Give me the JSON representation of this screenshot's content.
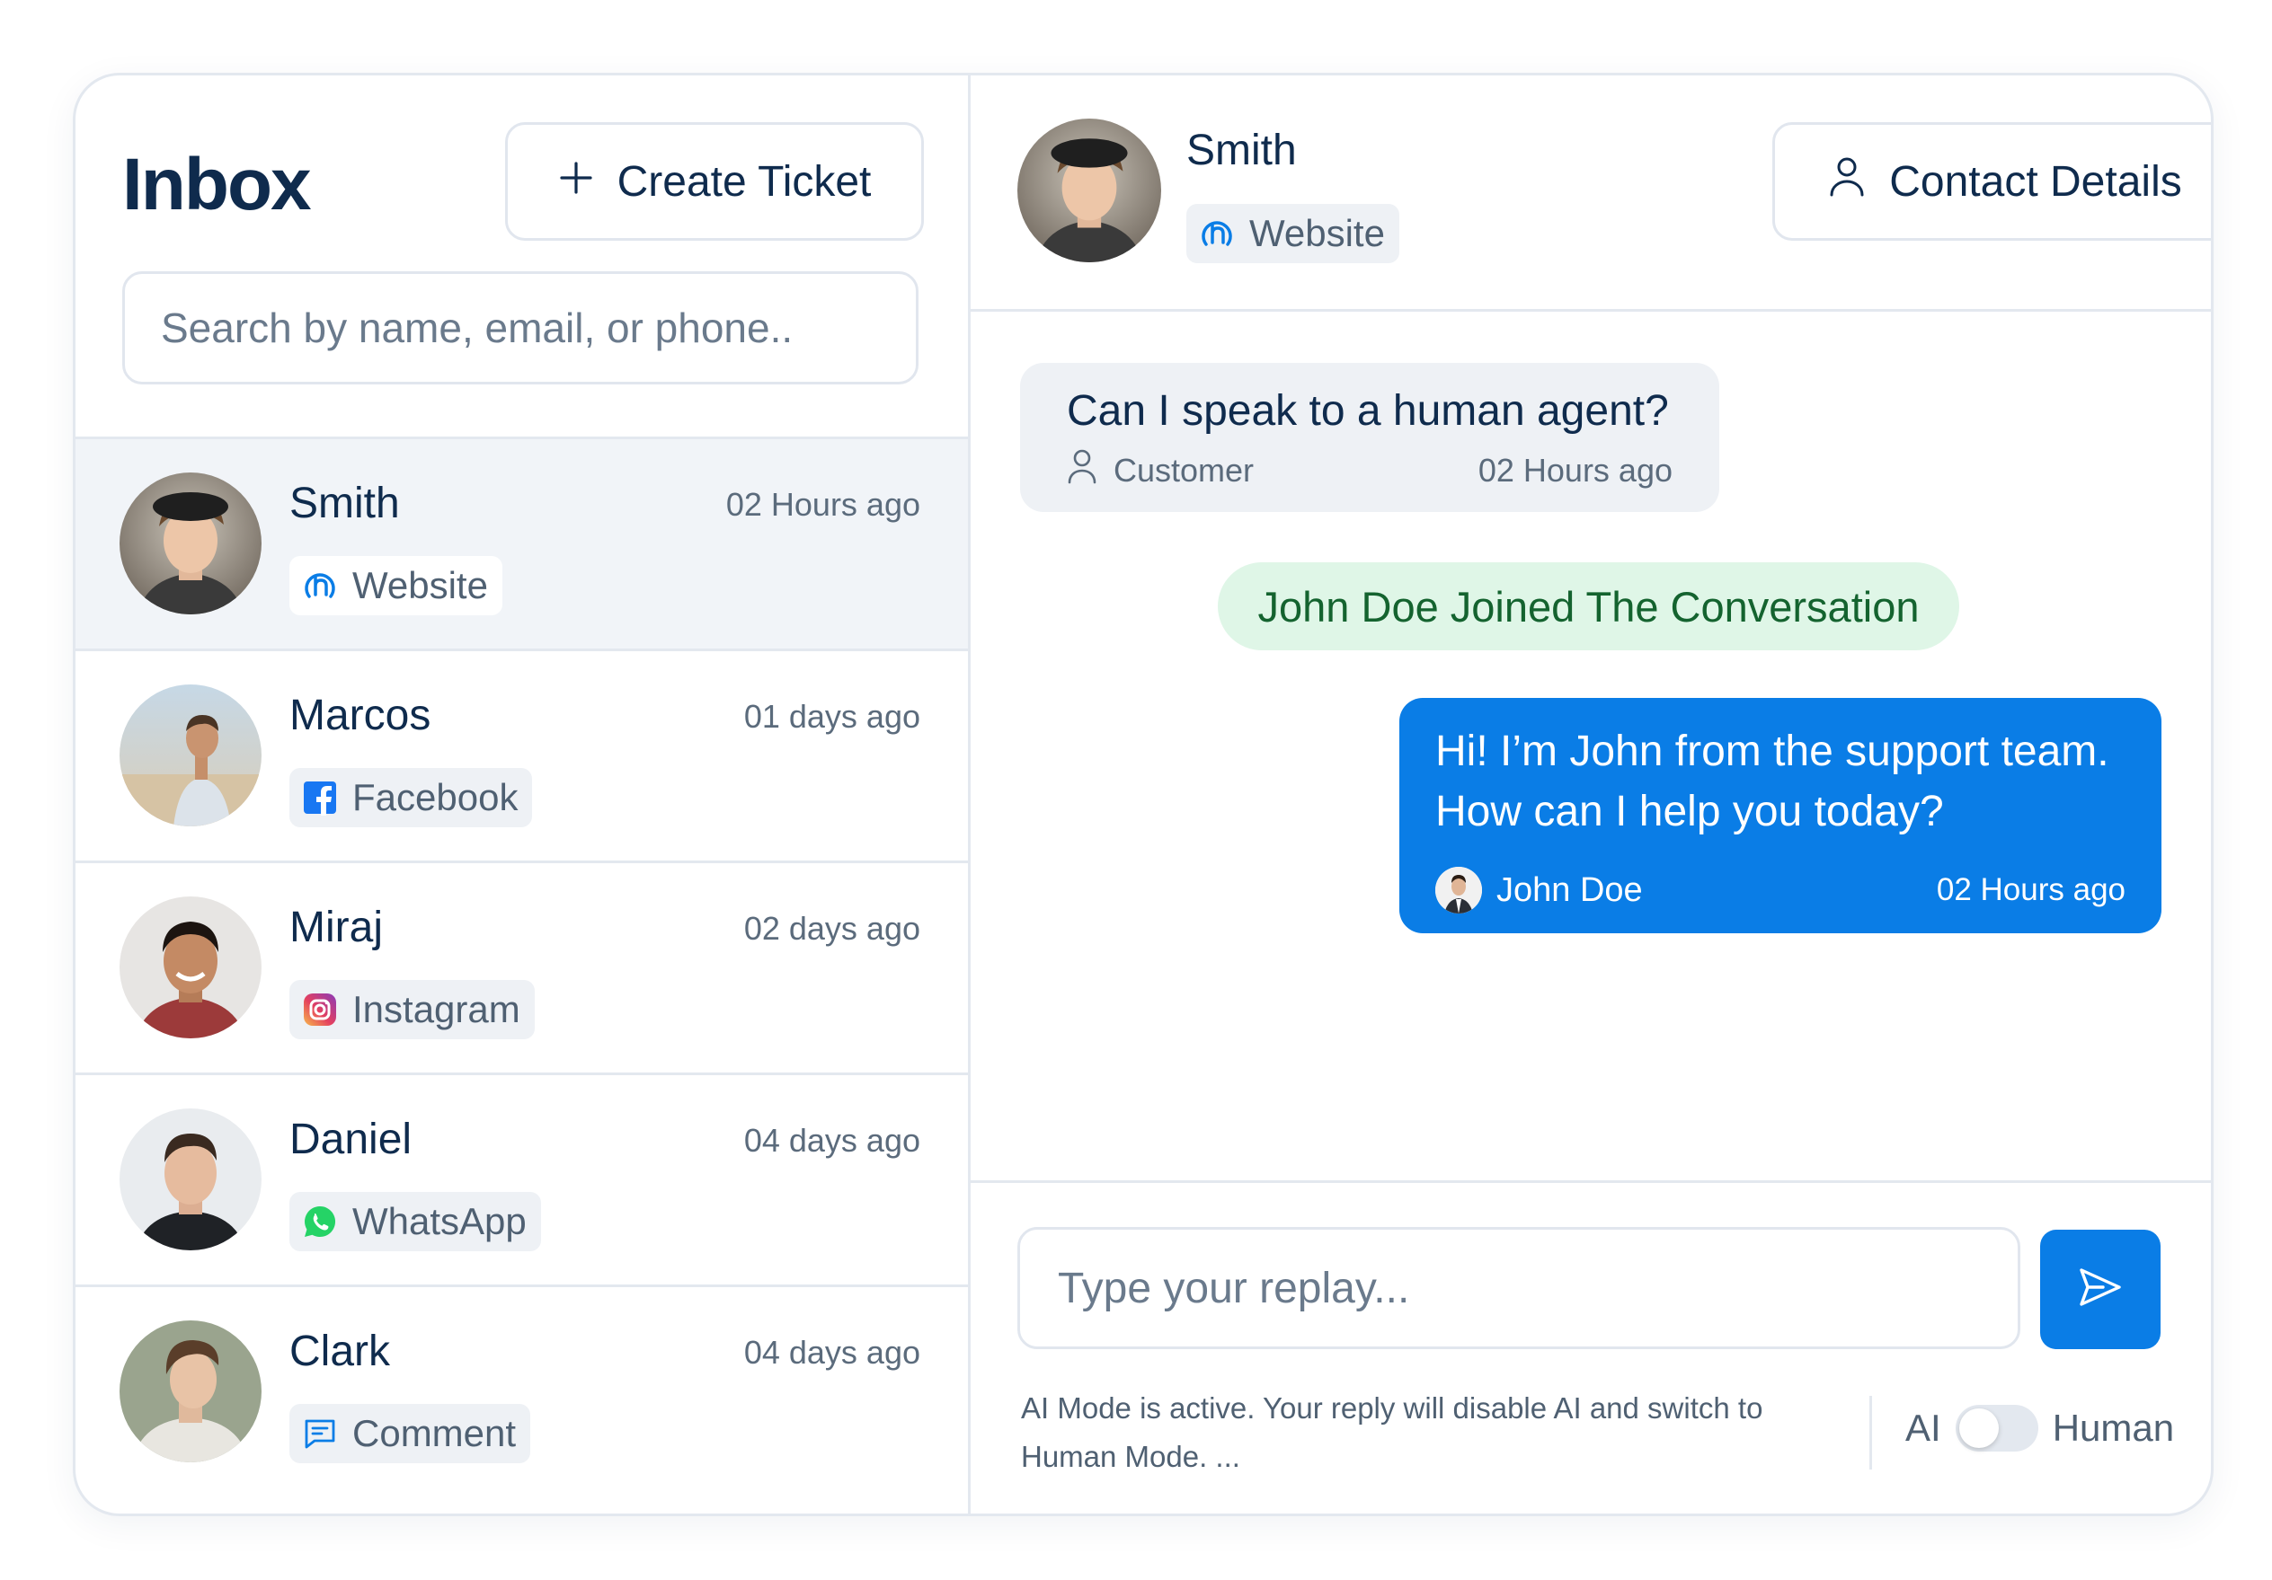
{
  "left": {
    "title": "Inbox",
    "create_label": "Create Ticket",
    "search_placeholder": "Search by name, email, or phone.."
  },
  "conversations": [
    {
      "name": "Smith",
      "time": "02 Hours ago",
      "channel": "Website",
      "icon": "website-icon",
      "active": true
    },
    {
      "name": "Marcos",
      "time": "01 days ago",
      "channel": "Facebook",
      "icon": "facebook-icon"
    },
    {
      "name": "Miraj",
      "time": "02 days ago",
      "channel": "Instagram",
      "icon": "instagram-icon"
    },
    {
      "name": "Daniel",
      "time": "04 days ago",
      "channel": "WhatsApp",
      "icon": "whatsapp-icon"
    },
    {
      "name": "Clark",
      "time": "04 days ago",
      "channel": "Comment",
      "icon": "comment-icon"
    }
  ],
  "chat": {
    "contact_name": "Smith",
    "contact_channel": "Website",
    "contact_details_label": "Contact Details",
    "messages": {
      "incoming": {
        "text": "Can I speak to a human agent?",
        "author": "Customer",
        "time": "02 Hours ago"
      },
      "system": "John Doe Joined The Conversation",
      "outgoing": {
        "line1": "Hi! I’m John from the support team.",
        "line2": "How can I help you today?",
        "author": "John Doe",
        "time": "02 Hours ago"
      }
    },
    "reply_placeholder": "Type your replay...",
    "ai_note_line1": "AI Mode is active. Your reply will disable AI and switch to",
    "ai_note_line2": "Human Mode. ...",
    "toggle_left": "AI",
    "toggle_right": "Human"
  },
  "colors": {
    "accent": "#0a7de6",
    "system_bg": "#dff6e7",
    "system_text": "#14632f",
    "text": "#0f2b4d"
  }
}
